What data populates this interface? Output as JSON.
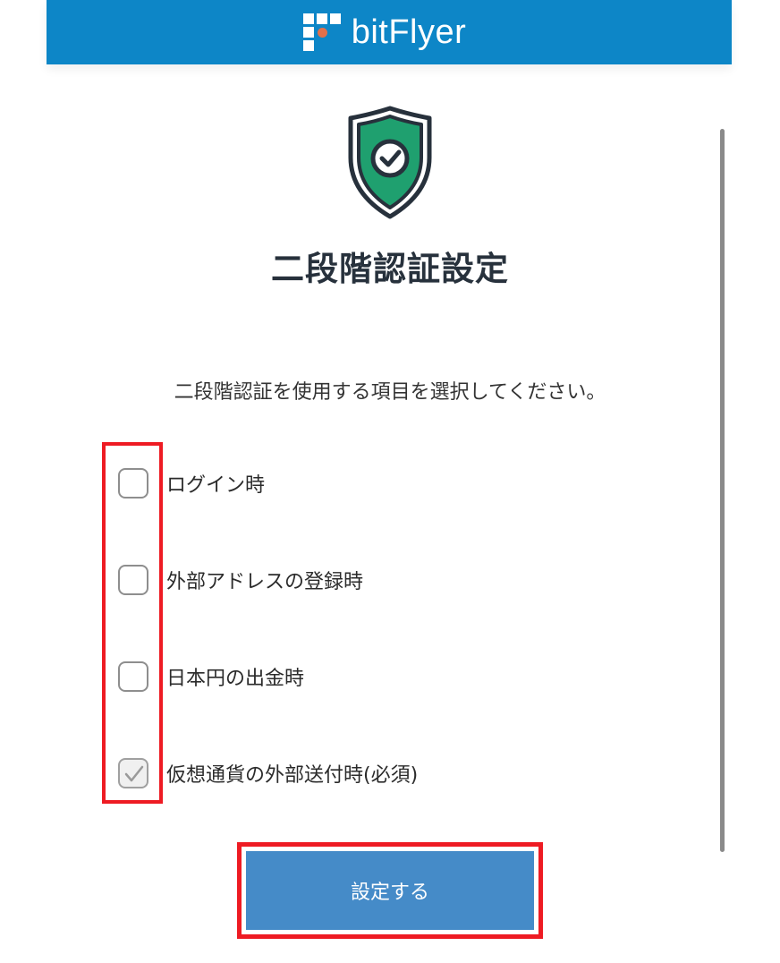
{
  "header": {
    "brand": "bitFlyer",
    "logo_icon": "bitflyer-logo-icon",
    "background": "#0d86c7"
  },
  "hero": {
    "icon": "shield-check-icon",
    "shield_color": "#1fa06f"
  },
  "page_title": "二段階認証設定",
  "instruction": "二段階認証を使用する項目を選択してください。",
  "options": [
    {
      "label": "ログイン時",
      "checked": false
    },
    {
      "label": "外部アドレスの登録時",
      "checked": false
    },
    {
      "label": "日本円の出金時",
      "checked": false
    },
    {
      "label": "仮想通貨の外部送付時(必須)",
      "checked": true
    }
  ],
  "submit": {
    "label": "設定する",
    "color": "#458bc8"
  },
  "annotations": {
    "highlight_color": "#ee1b23"
  }
}
